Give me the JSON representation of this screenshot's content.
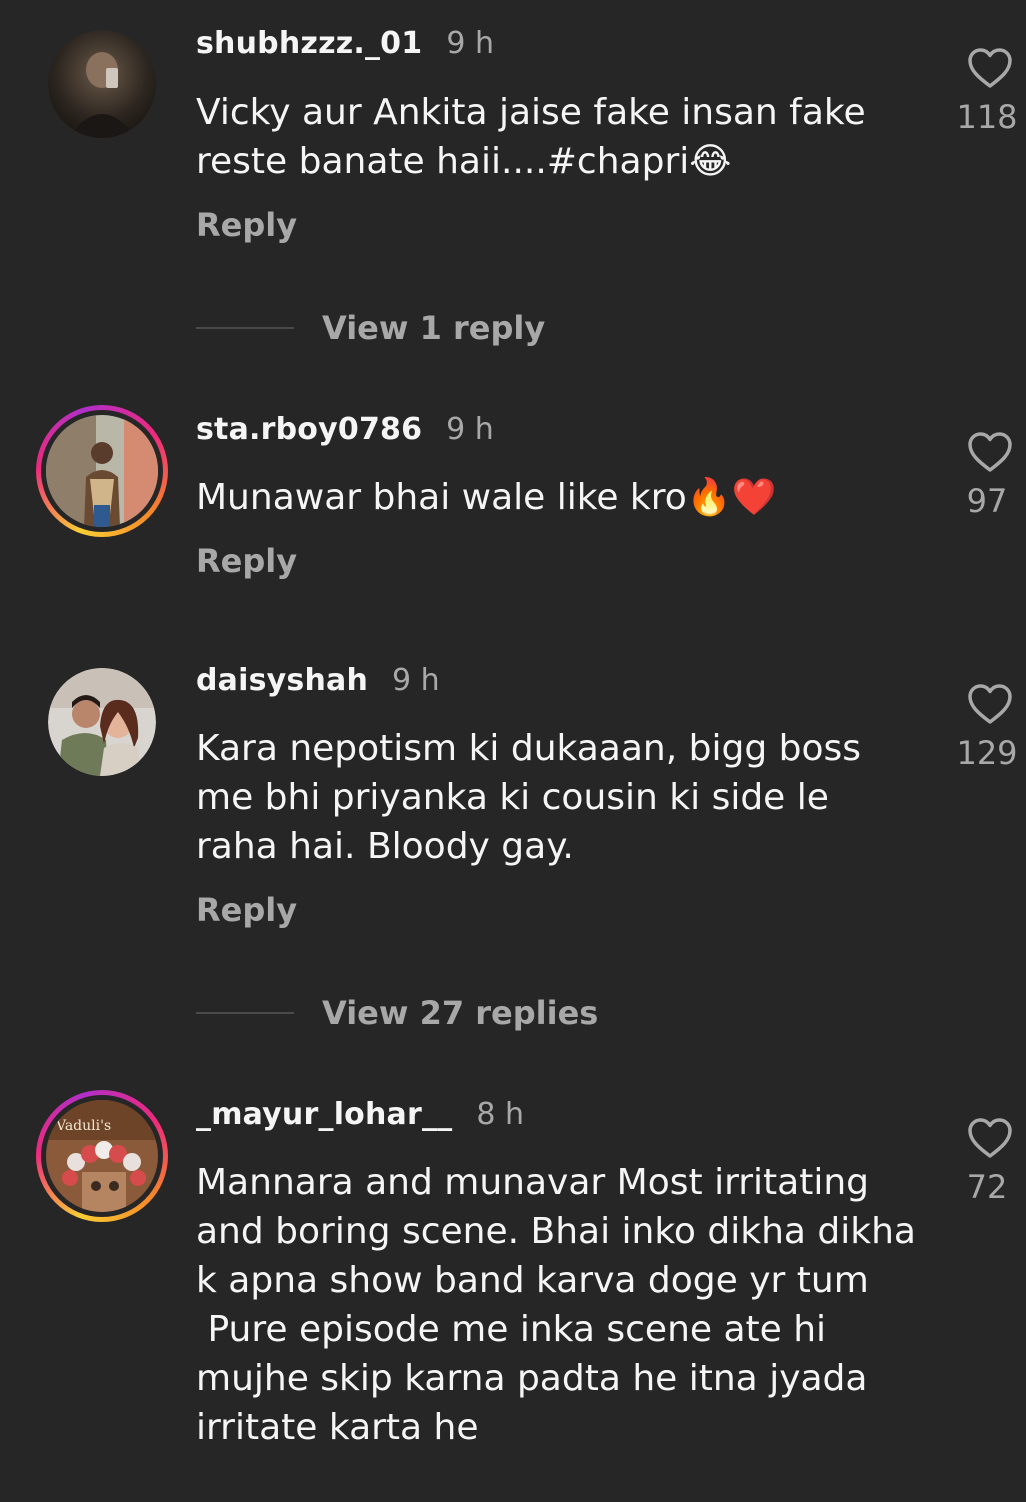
{
  "comments": [
    {
      "username": "shubhzzz._01",
      "time": "9 h",
      "text": "Vicky aur Ankita jaise fake insan fake reste banate haii....#chapri😂",
      "reply_label": "Reply",
      "likes": "118",
      "story_ring": false
    },
    {
      "username": "sta.rboy0786",
      "time": "9 h",
      "text": "Munawar bhai wale like kro🔥❤️",
      "reply_label": "Reply",
      "likes": "97",
      "story_ring": true
    },
    {
      "username": "daisyshah",
      "time": "9 h",
      "text": "Kara nepotism ki dukaaan, bigg boss me bhi priyanka ki cousin ki side le raha hai. Bloody gay.",
      "reply_label": "Reply",
      "likes": "129",
      "story_ring": false
    },
    {
      "username": "_mayur_lohar__",
      "time": "8 h",
      "text": "Mannara and munavar Most irritating and boring scene. Bhai inko dikha dikha k apna show band karva doge yr tum\n Pure episode me inka scene ate hi mujhe skip karna padta he itna jyada irritate karta he",
      "likes": "72",
      "story_ring": true
    }
  ],
  "view_replies": [
    {
      "label": "View 1 reply"
    },
    {
      "label": "View 27 replies"
    }
  ],
  "colors": {
    "background": "#262626",
    "text_primary": "#f5f5f5",
    "text_secondary": "#a8a8a8",
    "story_ring": [
      "#f9ce34",
      "#ee2a7b",
      "#b02fc9"
    ]
  },
  "icons": {
    "like": "heart-outline-icon"
  }
}
